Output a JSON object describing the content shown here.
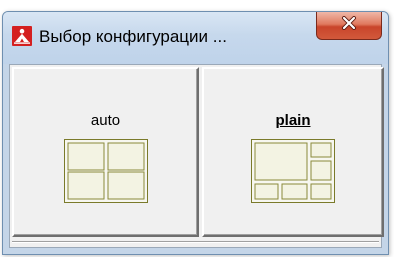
{
  "window": {
    "title": "Выбор конфигурации ...",
    "icon": "app-logo-icon",
    "close_icon": "close-icon",
    "accent_colors": {
      "titlebar": "#c6d8ec",
      "close_button": "#c9452b",
      "layout_cell_fill": "#f3f3e3",
      "layout_cell_border": "#7a7a2a"
    }
  },
  "configs": [
    {
      "label": "auto",
      "icon": "grid-2x2-layout-icon",
      "selected": false
    },
    {
      "label": "plain",
      "icon": "grid-mixed-layout-icon",
      "selected": true
    }
  ]
}
